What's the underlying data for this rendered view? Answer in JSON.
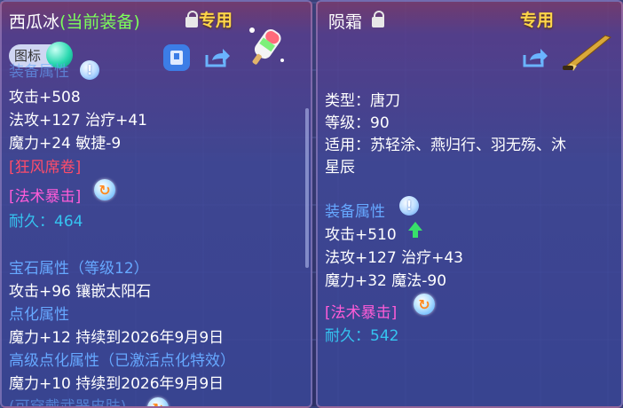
{
  "left": {
    "title_prefix": "西瓜冰",
    "title_highlight": "(当前装备)",
    "exclusive": "专用",
    "icon_badge": "图标",
    "section_cut": "装备属性",
    "attack": "攻击+508",
    "magic_heal": "法攻+127 治疗+41",
    "mana_agility": "魔力+24 敏捷-9",
    "special_red": "[狂风席卷]",
    "special_magenta": "[法术暴击]",
    "durability": "耐久：464",
    "gem_title": "宝石属性（等级12）",
    "gem_line": "攻击+96 镶嵌太阳石",
    "refine_title": "点化属性",
    "refine_line": "魔力+12 持续到2026年9月9日",
    "adv_refine_title": "高级点化属性（已激活点化特效）",
    "adv_refine_line": "魔力+10 持续到2026年9月9日",
    "cut_bottom": "(可穿戴武器皮肤)"
  },
  "right": {
    "title": "陨霜",
    "exclusive": "专用",
    "type": "类型：唐刀",
    "level": "等级：90",
    "usable_1": "适用：苏轻涂、燕归行、羽无殇、沐",
    "usable_2": "星辰",
    "attr_title": "装备属性",
    "attack": "攻击+510",
    "magic_heal": "法攻+127 治疗+43",
    "mana_magic": "魔力+32 魔法-90",
    "special_magenta": "[法术暴击]",
    "durability": "耐久：542"
  },
  "icons": {
    "lock": "lock-icon",
    "share": "share-icon",
    "info": "info-icon",
    "crit": "swirl-icon",
    "up": "up-arrow-icon"
  },
  "colors": {
    "title_highlight": "#7dff5a",
    "exclusive": "#ffd64a",
    "durability": "#35c4f0",
    "special_red": "#ff4c6a",
    "special_magenta": "#ff5cd8",
    "section": "#66a8ff",
    "upgrade": "#38e06a"
  }
}
